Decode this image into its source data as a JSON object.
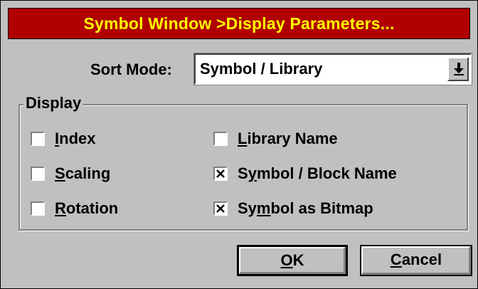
{
  "window": {
    "title": "Symbol Window >Display Parameters...",
    "title_bar_color": "#b00000",
    "title_text_color": "#ffff00",
    "background_color": "#c0c0c0"
  },
  "sort": {
    "label": "Sort Mode:",
    "selected_value": "Symbol / Library",
    "dropdown_icon": "dropdown-arrow-icon"
  },
  "display": {
    "group_label": "Display",
    "checkboxes": [
      {
        "label_pre": "",
        "mnemonic": "I",
        "label_post": "ndex",
        "checked": false
      },
      {
        "label_pre": "",
        "mnemonic": "S",
        "label_post": "caling",
        "checked": false
      },
      {
        "label_pre": "",
        "mnemonic": "R",
        "label_post": "otation",
        "checked": false
      },
      {
        "label_pre": "",
        "mnemonic": "L",
        "label_post": "ibrary Name",
        "checked": false
      },
      {
        "label_pre": "S",
        "mnemonic": "y",
        "label_post": "mbol / Block Name",
        "checked": true
      },
      {
        "label_pre": "Sy",
        "mnemonic": "m",
        "label_post": "bol as Bitmap",
        "checked": true
      }
    ]
  },
  "buttons": {
    "ok": {
      "mnemonic": "O",
      "rest": "K"
    },
    "cancel": {
      "mnemonic": "C",
      "rest": "ancel"
    }
  }
}
